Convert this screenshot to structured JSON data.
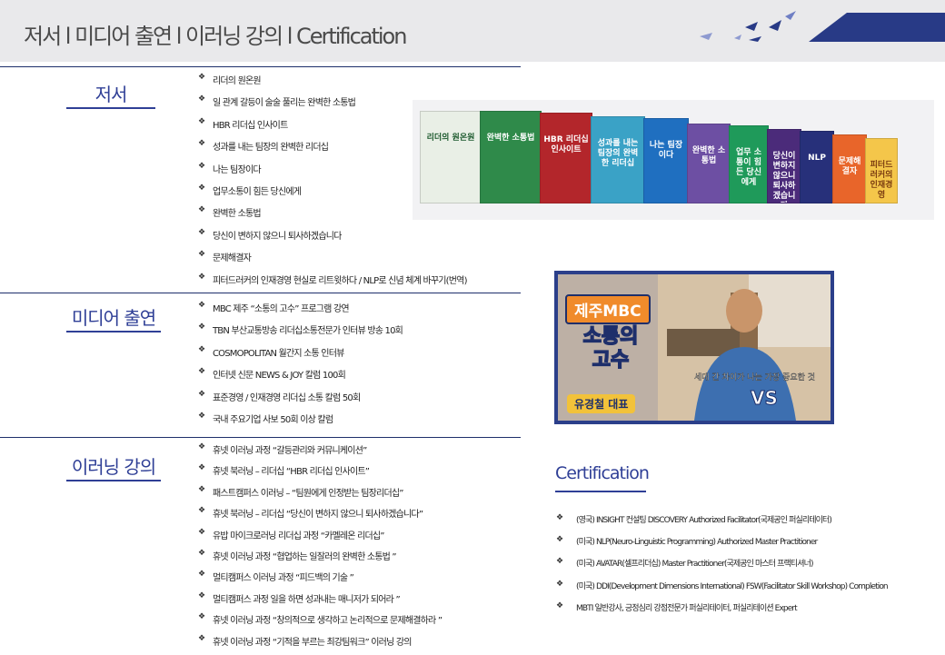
{
  "header": {
    "title": "저서 l 미디어 출연 l 이러닝 강의 l Certification"
  },
  "bullet": "❖",
  "sections": [
    {
      "label": "저서",
      "items": [
        "리더의 원온원",
        "일 관계 갈등이 술술 풀리는 완벽한 소통법",
        "HBR 리더십 인사이트",
        "성과를 내는 팀장의 완벽한 리더십",
        "나는 팀장이다",
        "업무소통이 힘든 당신에게",
        "완벽한 소통법",
        "당신이 변하지 않으니 퇴사하겠습니다",
        "문제해결자",
        "피터드러커의 인재경영 현실로 리트윗하다 / NLP로 신념 체계 바꾸기(번역)"
      ]
    },
    {
      "label": "미디어 출연",
      "items": [
        "MBC 제주 “소통의 고수” 프로그램 강연",
        "TBN 부산교통방송 리더십소통전문가 인터뷰 방송 10회",
        "COSMOPOLITAN 월간지 소통 인터뷰",
        "인터넷 신문 NEWS & JOY 칼럼 100회",
        "표준경영 / 인재경영 리더십 소통 칼럼 50회",
        "국내 주요기업 사보 50회 이상 칼럼"
      ]
    },
    {
      "label": "이러닝 강의",
      "items": [
        "휴넷 이러닝 과정 “갈등관리와 커뮤니케이션”",
        "휴넷 북러닝 – 리더십 “HBR 리더십 인사이트”",
        "패스트캠퍼스 이러닝 – “팀원에게 인정받는 팀장리더십”",
        "휴넷 북러닝 – 리더십 “당신이 변하지 않으니 퇴사하겠습니다”",
        "유밥 마이크로러닝 리더십 과정 “카멜레온 리더십”",
        "휴넷 이러닝 과정 “협업하는 일잘러의 완벽한 소통법 ”",
        "멀티캠퍼스 이러닝 과정 “피드백의 기술 ”",
        "멀티캠퍼스 과정 일을 하면 성과내는 매니저가 되어라 ”",
        "휴넷 이러닝 과정 “창의적으로 생각하고 논리적으로 문제해결하라 ”",
        "휴넷 이러닝 과정 “기적을 부르는 최강팀워크” 이러닝 강의"
      ]
    }
  ],
  "books": [
    {
      "title": "리더의 원온원",
      "color": "#e9efe6",
      "text": "#1d5a2e"
    },
    {
      "title": "완벽한 소통법",
      "color": "#2f8a4a",
      "text": "#ffffff"
    },
    {
      "title": "HBR 리더십 인사이트",
      "color": "#b3262b",
      "text": "#ffffff"
    },
    {
      "title": "성과를 내는 팀장의 완벽한 리더십",
      "color": "#3aa2c6",
      "text": "#ffffff"
    },
    {
      "title": "나는 팀장이다",
      "color": "#1f6fc0",
      "text": "#ffffff"
    },
    {
      "title": "완벽한 소통법",
      "color": "#6d4fa3",
      "text": "#ffffff"
    },
    {
      "title": "업무 소통이 힘든 당신에게",
      "color": "#1f9a5a",
      "text": "#ffffff"
    },
    {
      "title": "당신이 변하지 않으니 퇴사하겠습니다",
      "color": "#4b2b7a",
      "text": "#ffffff"
    },
    {
      "title": "NLP",
      "color": "#27307a",
      "text": "#ffffff"
    },
    {
      "title": "문제해결자",
      "color": "#e8652a",
      "text": "#ffffff"
    },
    {
      "title": "피터드러커의 인재경영",
      "color": "#f4c64a",
      "text": "#7a3b10"
    }
  ],
  "tv": {
    "channel": "제주MBC",
    "program": "소통의 고수",
    "presenter": "유경철 대표",
    "caption": "세대 간 차이가 나는 가장 중요한 것",
    "vs": "VS"
  },
  "certification": {
    "title": "Certification",
    "items": [
      "(영국) INSIGHT 컨설팅 DISCOVERY Authorized Facilitator(국제공인 퍼실리테이터)",
      "(미국) NLP(Neuro-Linguistic Programming) Authorized Master Practitioner",
      "(미국) AVATAR(셀프리더십) Master Practitioner(국제공인 마스터 프랙티셔너)",
      "(미국) DDI(Development Dimensions International) FSW(Facilitator Skill Workshop) Completion",
      "MBTI 일반강사, 긍정심리 강점전문가 퍼실리테이터, 퍼실리테이션 Expert"
    ]
  }
}
